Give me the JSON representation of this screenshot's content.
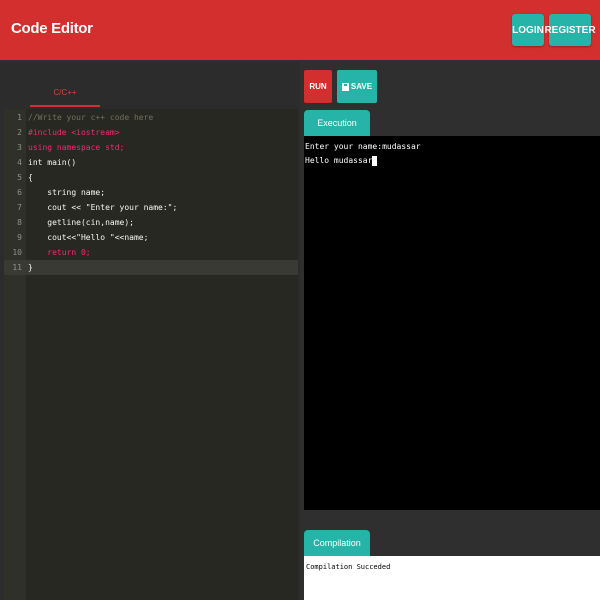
{
  "header": {
    "title": "Code Editor",
    "login_label": "LOGIN",
    "register_label": "REGISTER"
  },
  "editor": {
    "language_tab": "C/C++",
    "lines": [
      {
        "num": "1",
        "text": "//Write your c++ code here"
      },
      {
        "num": "2",
        "text": "#include <iostream>"
      },
      {
        "num": "3",
        "text": "using namespace std;"
      },
      {
        "num": "4",
        "text": "int main()"
      },
      {
        "num": "5",
        "text": "{"
      },
      {
        "num": "6",
        "text": "    string name;"
      },
      {
        "num": "7",
        "text": "    cout << \"Enter your name:\";"
      },
      {
        "num": "8",
        "text": "    getline(cin,name);"
      },
      {
        "num": "9",
        "text": "    cout<<\"Hello \"<<name;"
      },
      {
        "num": "10",
        "text": "    return 0;"
      },
      {
        "num": "11",
        "text": "}"
      }
    ]
  },
  "toolbar": {
    "run_label": "RUN",
    "save_label": "SAVE"
  },
  "execution": {
    "tab_label": "Execution",
    "output_lines": [
      "Enter your name:mudassar",
      "Hello mudassar"
    ]
  },
  "compilation": {
    "tab_label": "Compilation",
    "message": "Compilation Succeded"
  },
  "colors": {
    "header": "#d32f2f",
    "accent": "#26b3a8",
    "editor_bg": "#272822"
  }
}
